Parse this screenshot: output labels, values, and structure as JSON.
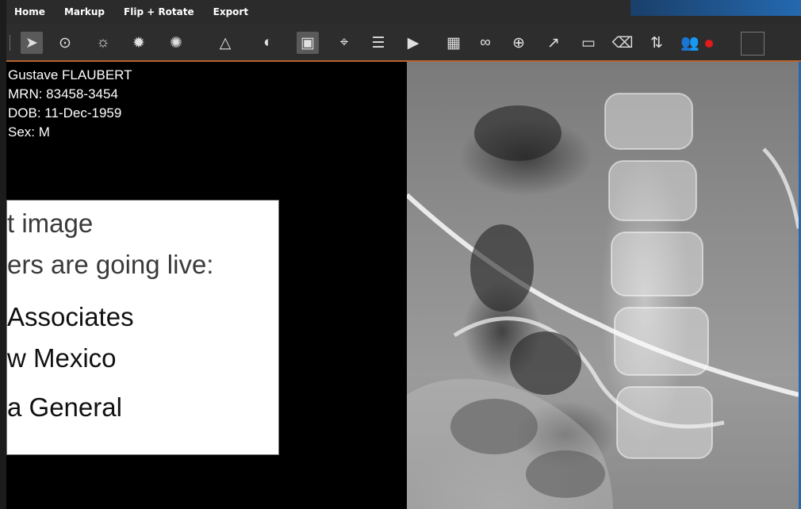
{
  "menu": {
    "tabs": [
      "Home",
      "Markup",
      "Flip + Rotate",
      "Export"
    ]
  },
  "toolbar": {
    "icons": [
      {
        "name": "select-pointer-icon",
        "glyph": "➤",
        "active": true
      },
      {
        "name": "zoom-fit-icon",
        "glyph": "⊙"
      },
      {
        "name": "brightness-icon",
        "glyph": "☼"
      },
      {
        "name": "auto-window-level-icon",
        "glyph": "✹"
      },
      {
        "name": "window-level-icon",
        "glyph": "✺"
      },
      {
        "name": "angle-measure-icon",
        "glyph": "△"
      },
      {
        "name": "invert-contrast-icon",
        "glyph": "◐"
      },
      {
        "name": "patient-info-toggle-icon",
        "glyph": "▣",
        "active": true
      },
      {
        "name": "crosshair-icon",
        "glyph": "⌖"
      },
      {
        "name": "stack-icon",
        "glyph": "☰"
      },
      {
        "name": "play-cine-icon",
        "glyph": "▶"
      },
      {
        "name": "layout-grid-icon",
        "glyph": "▦"
      },
      {
        "name": "link-icon",
        "glyph": "∞"
      },
      {
        "name": "zoom-in-icon",
        "glyph": "⊕"
      },
      {
        "name": "arrow-annotate-icon",
        "glyph": "↗"
      },
      {
        "name": "ruler-icon",
        "glyph": "▭"
      },
      {
        "name": "eraser-icon",
        "glyph": "⌫"
      },
      {
        "name": "swap-icon",
        "glyph": "⇅"
      },
      {
        "name": "users-icon",
        "glyph": "👥"
      }
    ],
    "record_dot_color": "#e01b1b"
  },
  "patient": {
    "name": "Gustave FLAUBERT",
    "mrn": "MRN: 83458-3454",
    "dob": "DOB: 11-Dec-1959",
    "sex": "Sex: M"
  },
  "overlay": {
    "line1": "t image",
    "line2": "ers are going live:",
    "line3": "Associates",
    "line4": "w Mexico",
    "line5": "a General"
  }
}
